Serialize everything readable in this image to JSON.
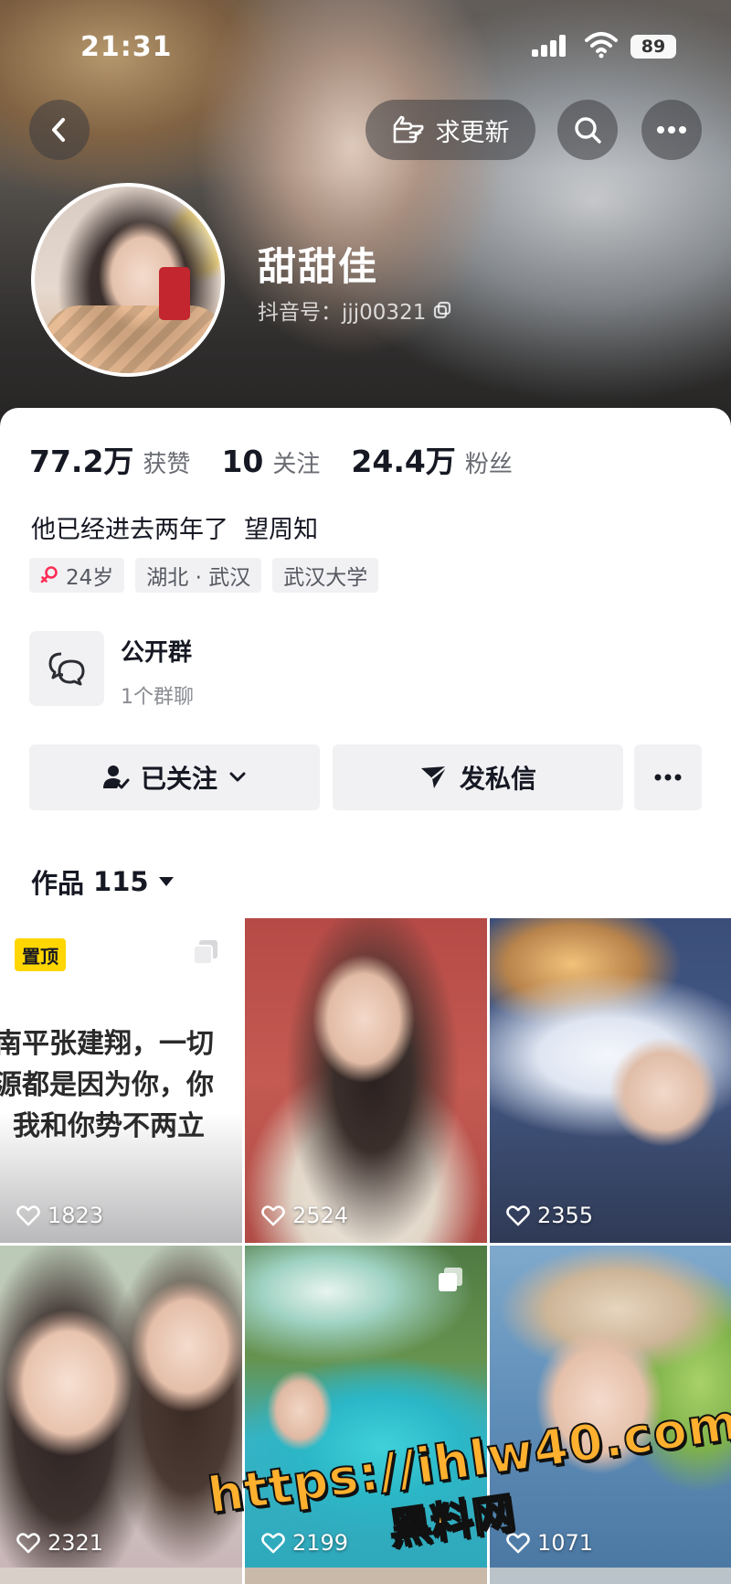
{
  "status_bar": {
    "time": "21:31",
    "battery": "89"
  },
  "header": {
    "request_update_label": "求更新",
    "nickname": "甜甜佳",
    "douyin_id": "抖音号：jjj00321"
  },
  "stats": [
    {
      "value": "77.2万",
      "label": "获赞"
    },
    {
      "value": "10",
      "label": "关注"
    },
    {
      "value": "24.4万",
      "label": "粉丝"
    }
  ],
  "bio": "他已经进去两年了  望周知",
  "tags": {
    "age": "24岁",
    "location": "湖北 · 武汉",
    "school": "武汉大学"
  },
  "group": {
    "title": "公开群",
    "subtitle": "1个群聊"
  },
  "actions": {
    "following_label": "已关注",
    "message_label": "发私信"
  },
  "works": {
    "label": "作品",
    "count": "115"
  },
  "posts": [
    {
      "likes": "1823",
      "pinned_label": "置顶",
      "text_lines": [
        "南平张建翔，一切",
        "源都是因为你，你",
        "我和你势不两立"
      ]
    },
    {
      "likes": "2524"
    },
    {
      "likes": "2355"
    },
    {
      "likes": "2321"
    },
    {
      "likes": "2199"
    },
    {
      "likes": "1071"
    }
  ],
  "watermark": {
    "url": "https://ihlw40.com",
    "name": "黑料网"
  },
  "colors": {
    "pin_badge": "#ffd600",
    "gender_female": "#fe2c55",
    "watermark": "#ffb02e"
  }
}
